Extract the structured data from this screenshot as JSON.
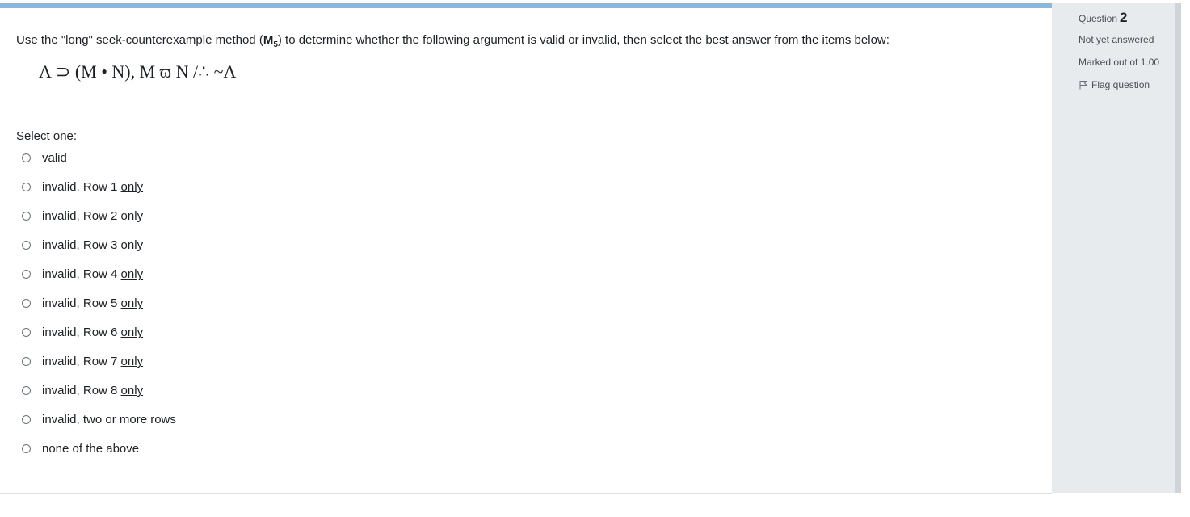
{
  "question": {
    "prompt_before": "Use the \"long\" seek-counterexample method (",
    "method_main": "M",
    "method_sub": "5",
    "prompt_after": ") to determine whether the following argument is valid or invalid, then select the best answer from the items below:",
    "formula": "Λ ⊃ (M • N), M ϖ N /∴ ~Λ",
    "select_label": "Select one:"
  },
  "options": [
    {
      "text": "valid",
      "underlined": ""
    },
    {
      "text": "invalid, Row 1 ",
      "underlined": "only"
    },
    {
      "text": "invalid, Row 2 ",
      "underlined": "only"
    },
    {
      "text": "invalid, Row 3 ",
      "underlined": "only"
    },
    {
      "text": "invalid, Row 4 ",
      "underlined": "only"
    },
    {
      "text": "invalid, Row 5 ",
      "underlined": "only"
    },
    {
      "text": "invalid, Row 6 ",
      "underlined": "only"
    },
    {
      "text": "invalid, Row 7 ",
      "underlined": "only"
    },
    {
      "text": "invalid, Row 8 ",
      "underlined": "only"
    },
    {
      "text": "invalid, two or more rows",
      "underlined": ""
    },
    {
      "text": "none of the above",
      "underlined": ""
    }
  ],
  "info": {
    "question_label": "Question",
    "question_number": "2",
    "state": "Not yet answered",
    "grade": "Marked out of 1.00",
    "flag_label": "Flag question",
    "flag_icon": "flag-icon"
  },
  "colors": {
    "top_bar": "#8ab8dc",
    "info_bg": "#e8ebee",
    "text": "#1d2125"
  }
}
